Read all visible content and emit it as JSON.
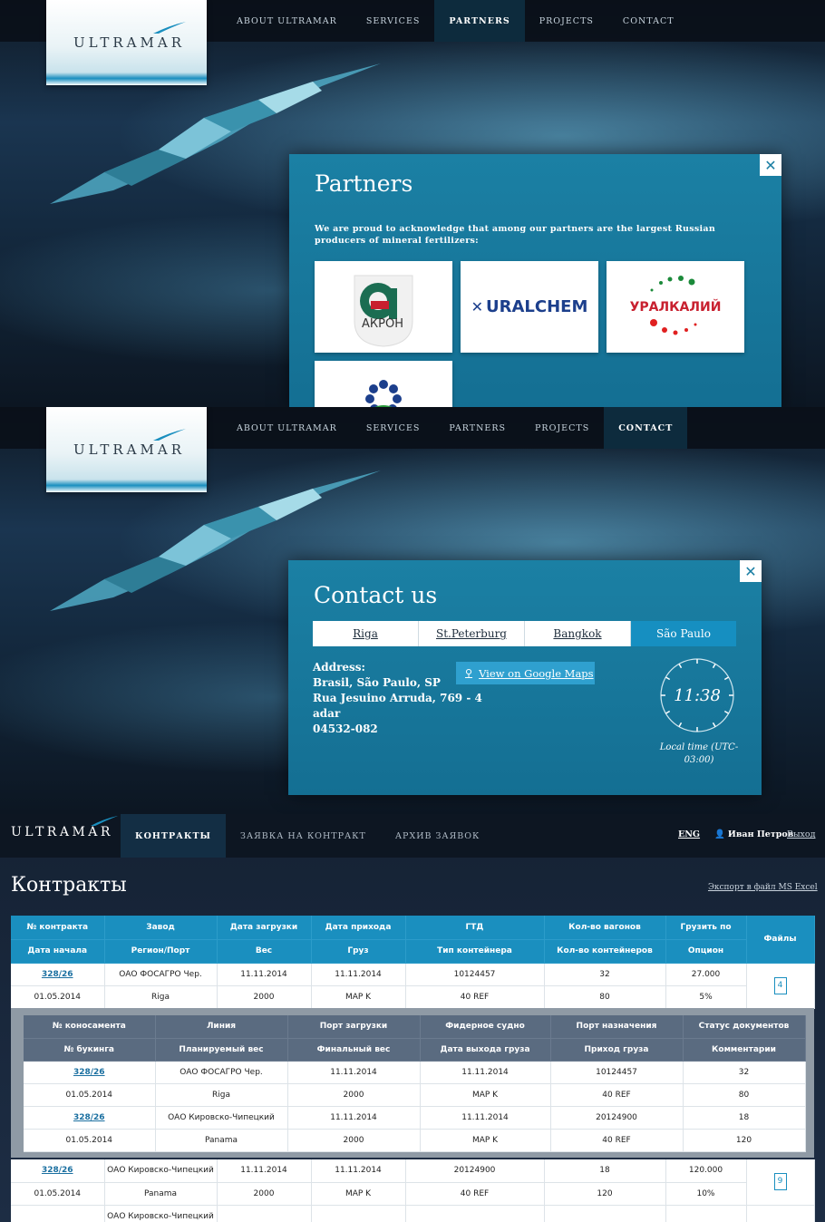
{
  "brand": "ULTRAMAR",
  "nav": [
    "ABOUT ULTRAMAR",
    "SERVICES",
    "PARTNERS",
    "PROJECTS",
    "CONTACT"
  ],
  "partners": {
    "title": "Partners",
    "intro": "We are proud to acknowledge that among our partners are the largest Russian producers of mineral fertilizers:",
    "logos": [
      {
        "name": "АКРОН"
      },
      {
        "name": "URALCHEM"
      },
      {
        "name": "УРАЛКАЛИЙ"
      },
      {
        "name": ""
      }
    ],
    "close": "✕"
  },
  "contact": {
    "title": "Contact us",
    "tabs": [
      "Riga",
      "St.Peterburg",
      "Bangkok",
      "São Paulo"
    ],
    "active_tab": "São Paulo",
    "address_label": "Address:",
    "address_lines": [
      "Brasil, São Paulo, SP",
      "Rua Jesuino Arruda, 769 - 4",
      "adar",
      "04532-082"
    ],
    "maps_link": "View on Google Maps",
    "time": "11:38",
    "local_time": "Local time (UTC-03:00)",
    "close": "✕"
  },
  "app": {
    "brand": "ULTRAMAR",
    "nav": [
      "КОНТРАКТЫ",
      "ЗАЯВКА НА КОНТРАКТ",
      "АРХИВ ЗАЯВОК"
    ],
    "lang": "ENG",
    "user": "Иван Петров",
    "logout": "Выход",
    "title": "Контракты",
    "export": "Экспорт в файл MS Excel",
    "headers_top": [
      "№ контракта",
      "Завод",
      "Дата загрузки",
      "Дата прихода",
      "ГТД",
      "Кол-во вагонов",
      "Грузить по",
      "Файлы"
    ],
    "headers_bottom": [
      "Дата начала",
      "Регион/Порт",
      "Вес",
      "Груз",
      "Тип контейнера",
      "Кол-во контейнеров",
      "Опцион"
    ],
    "rows": [
      {
        "top": [
          "328/26",
          "ОАО ФОСАГРО Чер.",
          "11.11.2014",
          "11.11.2014",
          "10124457",
          "32",
          "27.000"
        ],
        "bottom": [
          "01.05.2014",
          "Riga",
          "2000",
          "MAP K",
          "40 REF",
          "80",
          "5%"
        ],
        "files": "4"
      },
      {
        "top": [
          "328/26",
          "ОАО Кировско-Чипецкий",
          "11.11.2014",
          "11.11.2014",
          "20124900",
          "18",
          "120.000"
        ],
        "bottom": [
          "01.05.2014",
          "Panama",
          "2000",
          "MAP K",
          "40 REF",
          "120",
          "10%"
        ],
        "files": "9"
      },
      {
        "top": [
          "",
          "ОАО Кировско-Чипецкий",
          "",
          "",
          "",
          "",
          ""
        ]
      }
    ],
    "sub_headers_top": [
      "№ коносамента",
      "Линия",
      "Порт загрузки",
      "Фидерное судно",
      "Порт назначения",
      "Статус документов"
    ],
    "sub_headers_bottom": [
      "№ букинга",
      "Планируемый вес",
      "Финальный вес",
      "Дата выхода груза",
      "Приход груза",
      "Комментарии"
    ],
    "sub_rows": [
      [
        "328/26",
        "ОАО ФОСАГРО Чер.",
        "11.11.2014",
        "11.11.2014",
        "10124457",
        "32"
      ],
      [
        "01.05.2014",
        "Riga",
        "2000",
        "MAP K",
        "40 REF",
        "80"
      ],
      [
        "328/26",
        "ОАО Кировско-Чипецкий",
        "11.11.2014",
        "11.11.2014",
        "20124900",
        "18"
      ],
      [
        "01.05.2014",
        "Panama",
        "2000",
        "MAP K",
        "40 REF",
        "120"
      ]
    ]
  }
}
